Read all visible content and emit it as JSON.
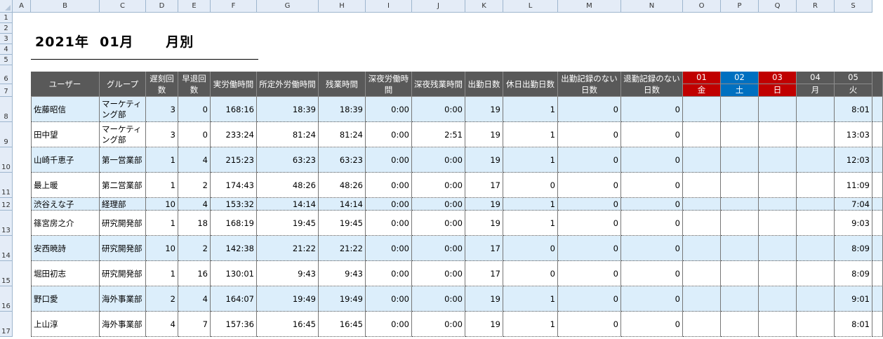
{
  "sheet": {
    "columns": [
      "A",
      "B",
      "C",
      "D",
      "E",
      "F",
      "G",
      "H",
      "I",
      "J",
      "K",
      "L",
      "M",
      "N",
      "O",
      "P",
      "Q",
      "R",
      "S"
    ],
    "rows": [
      "1",
      "2",
      "3",
      "4",
      "5",
      "6",
      "7",
      "8",
      "9",
      "10",
      "11",
      "12",
      "13",
      "14",
      "15",
      "16",
      "17"
    ]
  },
  "title": "2021年  01月      月別",
  "headers": [
    "ユーザー",
    "グループ",
    "遅刻回数",
    "早退回数",
    "実労働時間",
    "所定外労働時間",
    "残業時間",
    "深夜労働時間",
    "深夜残業時間",
    "出勤日数",
    "休日出勤日数",
    "出勤記録のない日数",
    "退勤記録のない日数"
  ],
  "days": [
    {
      "num": "01",
      "dow": "金",
      "color": "#c00000"
    },
    {
      "num": "02",
      "dow": "土",
      "color": "#0070c0"
    },
    {
      "num": "03",
      "dow": "日",
      "color": "#c00000"
    },
    {
      "num": "04",
      "dow": "月",
      "color": "#595959"
    },
    {
      "num": "05",
      "dow": "火",
      "color": "#595959"
    }
  ],
  "records": [
    {
      "user": "佐藤昭信",
      "group": "マーケティング部",
      "late": "3",
      "early": "0",
      "actual": "168:16",
      "over": "18:39",
      "ot": "18:39",
      "night": "0:00",
      "nightot": "0:00",
      "days": "19",
      "holiday": "1",
      "noin": "0",
      "noout": "0",
      "d05": "8:01"
    },
    {
      "user": "田中望",
      "group": "マーケティング部",
      "late": "3",
      "early": "0",
      "actual": "233:24",
      "over": "81:24",
      "ot": "81:24",
      "night": "0:00",
      "nightot": "2:51",
      "days": "19",
      "holiday": "1",
      "noin": "0",
      "noout": "0",
      "d05": "13:03"
    },
    {
      "user": "山崎千恵子",
      "group": "第一営業部",
      "late": "1",
      "early": "4",
      "actual": "215:23",
      "over": "63:23",
      "ot": "63:23",
      "night": "0:00",
      "nightot": "0:00",
      "days": "19",
      "holiday": "1",
      "noin": "0",
      "noout": "0",
      "d05": "12:03"
    },
    {
      "user": "最上暖",
      "group": "第二営業部",
      "late": "1",
      "early": "2",
      "actual": "174:43",
      "over": "48:26",
      "ot": "48:26",
      "night": "0:00",
      "nightot": "0:00",
      "days": "17",
      "holiday": "0",
      "noin": "0",
      "noout": "0",
      "d05": "11:09"
    },
    {
      "user": "渋谷えな子",
      "group": "経理部",
      "late": "10",
      "early": "4",
      "actual": "153:32",
      "over": "14:14",
      "ot": "14:14",
      "night": "0:00",
      "nightot": "0:00",
      "days": "19",
      "holiday": "1",
      "noin": "0",
      "noout": "0",
      "d05": "7:04"
    },
    {
      "user": "篠宮房之介",
      "group": "研究開発部",
      "late": "1",
      "early": "18",
      "actual": "168:19",
      "over": "19:45",
      "ot": "19:45",
      "night": "0:00",
      "nightot": "0:00",
      "days": "19",
      "holiday": "1",
      "noin": "0",
      "noout": "0",
      "d05": "9:03"
    },
    {
      "user": "安西暁詩",
      "group": "研究開発部",
      "late": "10",
      "early": "2",
      "actual": "142:38",
      "over": "21:22",
      "ot": "21:22",
      "night": "0:00",
      "nightot": "0:00",
      "days": "17",
      "holiday": "0",
      "noin": "0",
      "noout": "0",
      "d05": "8:09"
    },
    {
      "user": "堀田初志",
      "group": "研究開発部",
      "late": "1",
      "early": "16",
      "actual": "130:01",
      "over": "9:43",
      "ot": "9:43",
      "night": "0:00",
      "nightot": "0:00",
      "days": "17",
      "holiday": "0",
      "noin": "0",
      "noout": "0",
      "d05": "8:09"
    },
    {
      "user": "野口愛",
      "group": "海外事業部",
      "late": "2",
      "early": "4",
      "actual": "164:07",
      "over": "19:49",
      "ot": "19:49",
      "night": "0:00",
      "nightot": "0:00",
      "days": "19",
      "holiday": "1",
      "noin": "0",
      "noout": "0",
      "d05": "9:01"
    },
    {
      "user": "上山淳",
      "group": "海外事業部",
      "late": "4",
      "early": "7",
      "actual": "157:36",
      "over": "16:45",
      "ot": "16:45",
      "night": "0:00",
      "nightot": "0:00",
      "days": "19",
      "holiday": "1",
      "noin": "0",
      "noout": "0",
      "d05": "8:01"
    }
  ]
}
